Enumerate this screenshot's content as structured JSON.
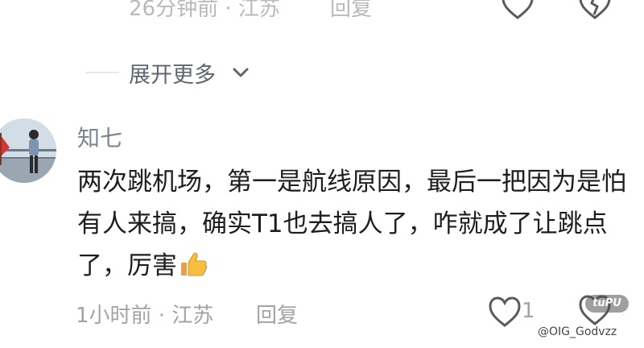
{
  "prev_comment": {
    "meta": "26分钟前 · 江苏",
    "reply_label": "回复"
  },
  "expand": {
    "label": "展开更多"
  },
  "comment": {
    "username": "知七",
    "content": "两次跳机场，第一是航线原因，最后一把因为是怕有人来搞，确实T1也去搞人了，咋就成了让跳点了，厉害",
    "meta": "1小时前 · 江苏",
    "reply_label": "回复",
    "like_count": "1",
    "emoji": "thumbs-up"
  },
  "watermark": {
    "badge": "tuPU",
    "text": "@OIG_Godvzz"
  },
  "colors": {
    "meta_gray": "#a3a3a3",
    "username_gray": "#7c8594",
    "text": "#1d1d1d"
  }
}
